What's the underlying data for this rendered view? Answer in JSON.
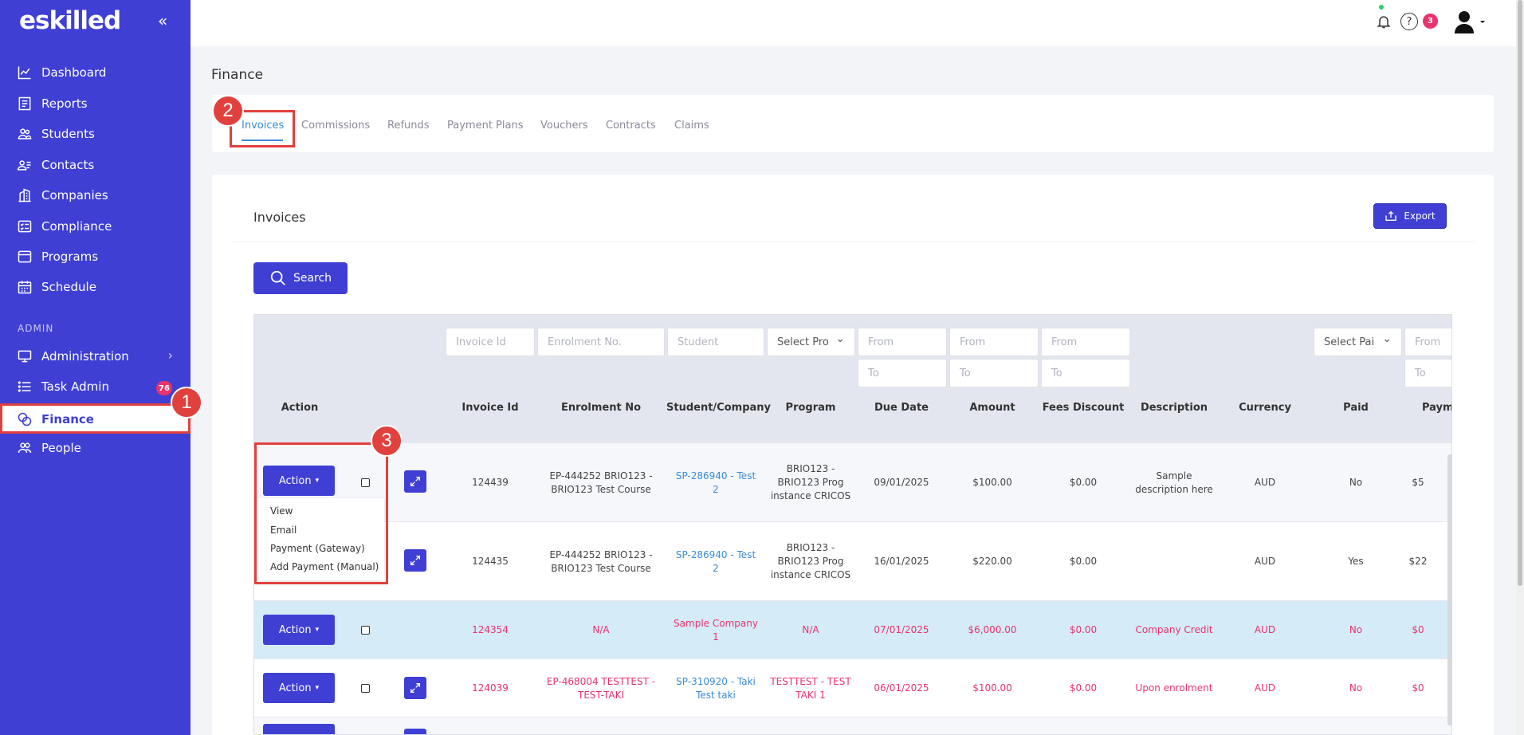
{
  "sidebar": {
    "logo": "eskilled",
    "collapse_icon": "«",
    "items": [
      {
        "label": "Dashboard",
        "icon": "chart-line-icon"
      },
      {
        "label": "Reports",
        "icon": "reports-icon"
      },
      {
        "label": "Students",
        "icon": "students-icon"
      },
      {
        "label": "Contacts",
        "icon": "contacts-icon"
      },
      {
        "label": "Companies",
        "icon": "building-icon"
      },
      {
        "label": "Compliance",
        "icon": "checklist-icon"
      },
      {
        "label": "Programs",
        "icon": "browser-icon"
      },
      {
        "label": "Schedule",
        "icon": "calendar-icon"
      }
    ],
    "admin_label": "ADMIN",
    "admin_items": [
      {
        "label": "Administration",
        "icon": "monitor-icon",
        "chevron": "›"
      },
      {
        "label": "Task Admin",
        "icon": "list-icon",
        "badge": "76"
      },
      {
        "label": "Finance",
        "icon": "finance-icon"
      },
      {
        "label": "People",
        "icon": "people-icon"
      }
    ]
  },
  "topbar": {
    "help_badge": "3"
  },
  "callouts": [
    "1",
    "2",
    "3"
  ],
  "page": {
    "title": "Finance"
  },
  "tabs": [
    "Invoices",
    "Commissions",
    "Refunds",
    "Payment Plans",
    "Vouchers",
    "Contracts",
    "Claims"
  ],
  "card": {
    "title": "Invoices",
    "export_label": "Export",
    "search_label": "Search"
  },
  "filters": {
    "invoice_id": "Invoice Id",
    "enrolment": "Enrolment No.",
    "student": "Student",
    "program": "Select Pro",
    "from": "From",
    "to": "To",
    "paid": "Select Pai"
  },
  "columns": [
    "Action",
    "Invoice Id",
    "Enrolment No",
    "Student/Company",
    "Program",
    "Due Date",
    "Amount",
    "Fees Discount",
    "Description",
    "Currency",
    "Paid",
    "Paym"
  ],
  "action_label": "Action",
  "dropdown": [
    "View",
    "Email",
    "Payment (Gateway)",
    "Add Payment (Manual)"
  ],
  "rows": [
    {
      "invoice": "124439",
      "enrolment": "EP-444252 BRIO123 - BRIO123 Test Course",
      "student": "SP-286940 - Test 2",
      "program": "BRIO123 - BRIO123 Prog instance CRICOS",
      "due": "09/01/2025",
      "amount": "$100.00",
      "discount": "$0.00",
      "description": "Sample description here",
      "currency": "AUD",
      "paid": "No",
      "payment": "$5"
    },
    {
      "invoice": "124435",
      "enrolment": "EP-444252 BRIO123 - BRIO123 Test Course",
      "student": "SP-286940 - Test 2",
      "program": "BRIO123 - BRIO123 Prog instance CRICOS",
      "due": "16/01/2025",
      "amount": "$220.00",
      "discount": "$0.00",
      "description": "",
      "currency": "AUD",
      "paid": "Yes",
      "payment": "$22"
    },
    {
      "invoice": "124354",
      "enrolment": "N/A",
      "student": "Sample Company 1",
      "program": "N/A",
      "due": "07/01/2025",
      "amount": "$6,000.00",
      "discount": "$0.00",
      "description": "Company Credit",
      "currency": "AUD",
      "paid": "No",
      "payment": "$0"
    },
    {
      "invoice": "124039",
      "enrolment": "EP-468004 TESTTEST - TEST-TAKI",
      "student": "SP-310920 - Taki Test taki",
      "program": "TESTTEST - TEST TAKI 1",
      "due": "06/01/2025",
      "amount": "$100.00",
      "discount": "$0.00",
      "description": "Upon enrolment",
      "currency": "AUD",
      "paid": "No",
      "payment": "$0"
    }
  ]
}
